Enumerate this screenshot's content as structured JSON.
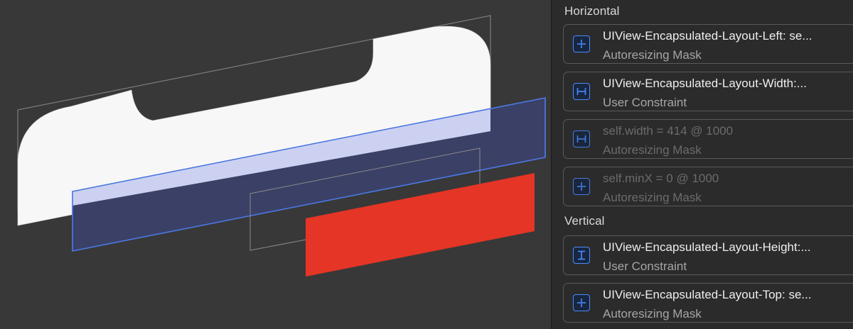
{
  "canvas": {
    "colors": {
      "background": "#383838",
      "superview_fill": "#f7f7f7",
      "selected_fill": "#3b4066",
      "selected_top_face": "#ccd1f2",
      "selected_stroke": "#4b77e0",
      "red_view": "#e53526",
      "wireframe": "#8a8a8a"
    }
  },
  "inspector": {
    "sections": [
      {
        "title": "Horizontal",
        "rows": [
          {
            "title": "UIView-Encapsulated-Layout-Left: se...",
            "subtitle": "Autoresizing Mask",
            "icon": "position-crosshair-icon",
            "dimmed": false
          },
          {
            "title": "UIView-Encapsulated-Layout-Width:...",
            "subtitle": "User Constraint",
            "icon": "width-constraint-icon",
            "dimmed": false
          },
          {
            "title": "self.width = 414 @ 1000",
            "subtitle": "Autoresizing Mask",
            "icon": "width-constraint-icon",
            "dimmed": true
          },
          {
            "title": "self.minX = 0 @ 1000",
            "subtitle": "Autoresizing Mask",
            "icon": "position-crosshair-icon",
            "dimmed": true
          }
        ]
      },
      {
        "title": "Vertical",
        "rows": [
          {
            "title": "UIView-Encapsulated-Layout-Height:...",
            "subtitle": "User Constraint",
            "icon": "height-constraint-icon",
            "dimmed": false
          },
          {
            "title": "UIView-Encapsulated-Layout-Top: se...",
            "subtitle": "Autoresizing Mask",
            "icon": "position-crosshair-icon",
            "dimmed": false
          }
        ]
      }
    ],
    "colors": {
      "panel": "#2b2b2b",
      "row_border": "#5a5a5a",
      "icon_accent": "#4a8cff",
      "text_primary": "#eeeeee",
      "text_secondary": "#a6a6a6",
      "text_dimmed": "#6b6b6b"
    }
  }
}
